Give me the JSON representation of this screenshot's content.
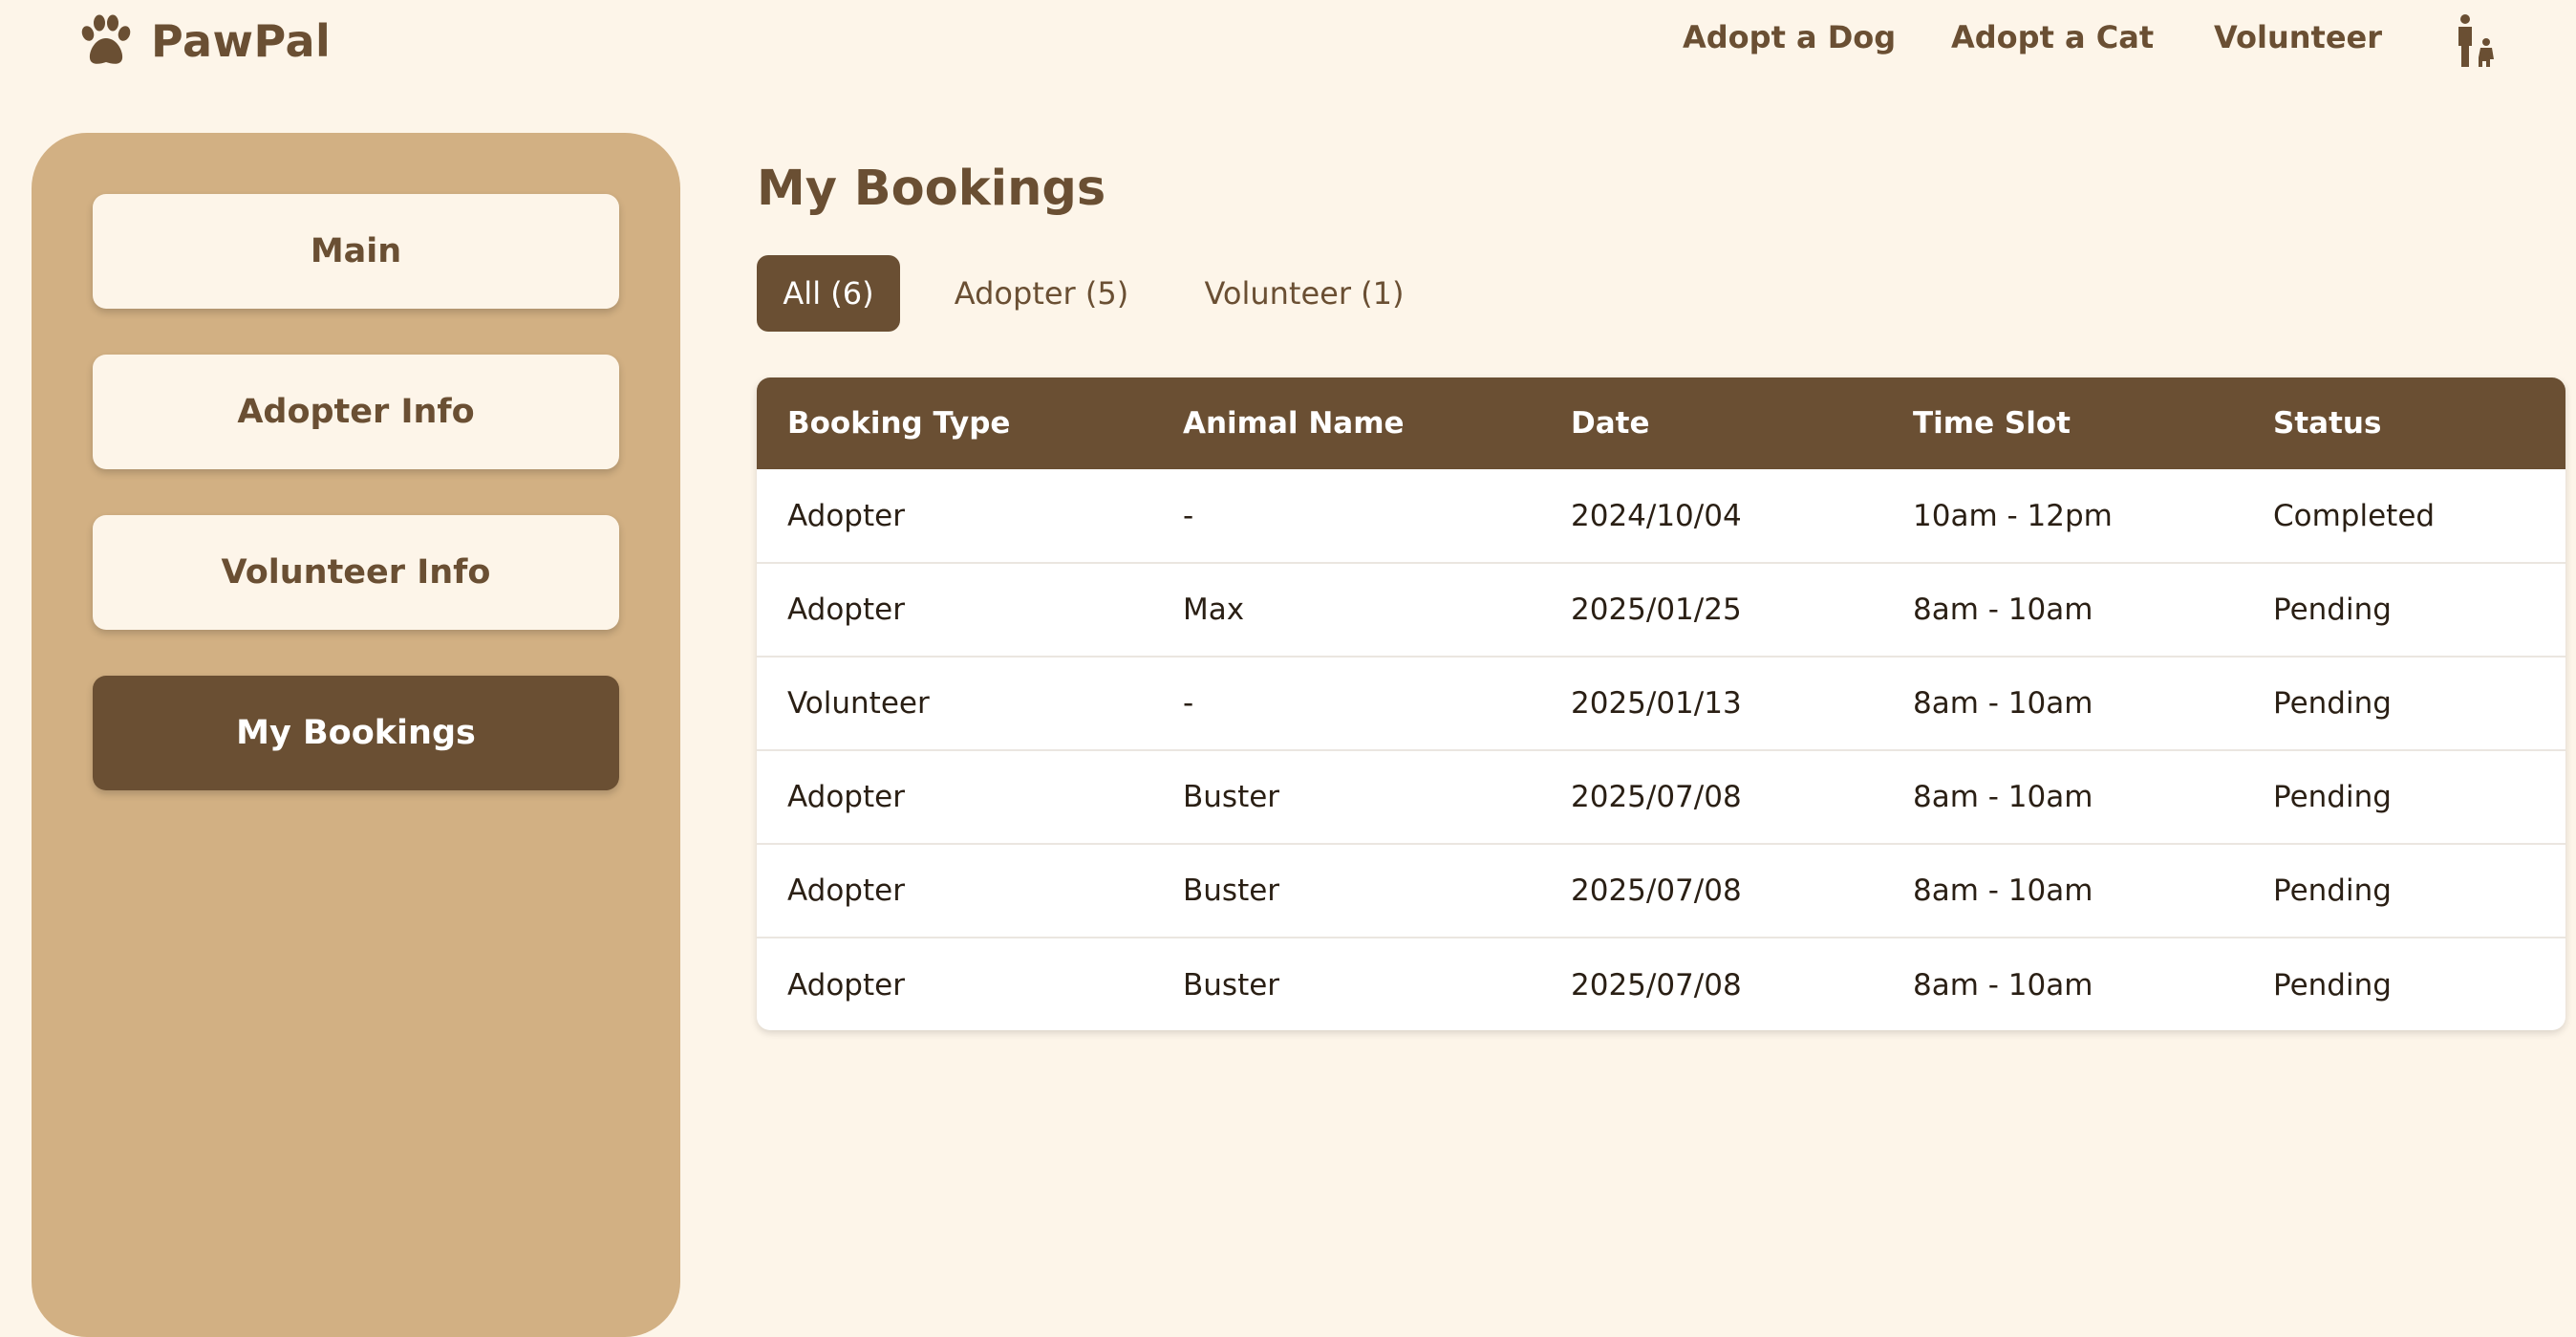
{
  "brand": {
    "name": "PawPal"
  },
  "nav": {
    "links": [
      "Adopt a Dog",
      "Adopt a Cat",
      "Volunteer"
    ]
  },
  "sidebar": {
    "items": [
      {
        "label": "Main",
        "active": false
      },
      {
        "label": "Adopter Info",
        "active": false
      },
      {
        "label": "Volunteer Info",
        "active": false
      },
      {
        "label": "My Bookings",
        "active": true
      }
    ]
  },
  "main": {
    "title": "My Bookings",
    "tabs": [
      {
        "label": "All (6)",
        "active": true
      },
      {
        "label": "Adopter (5)",
        "active": false
      },
      {
        "label": "Volunteer (1)",
        "active": false
      }
    ],
    "table": {
      "columns": [
        "Booking Type",
        "Animal Name",
        "Date",
        "Time Slot",
        "Status"
      ],
      "rows": [
        [
          "Adopter",
          "-",
          "2024/10/04",
          "10am - 12pm",
          "Completed"
        ],
        [
          "Adopter",
          "Max",
          "2025/01/25",
          "8am - 10am",
          "Pending"
        ],
        [
          "Volunteer",
          "-",
          "2025/01/13",
          "8am - 10am",
          "Pending"
        ],
        [
          "Adopter",
          "Buster",
          "2025/07/08",
          "8am - 10am",
          "Pending"
        ],
        [
          "Adopter",
          "Buster",
          "2025/07/08",
          "8am - 10am",
          "Pending"
        ],
        [
          "Adopter",
          "Buster",
          "2025/07/08",
          "8am - 10am",
          "Pending"
        ]
      ]
    }
  },
  "icons": {
    "brand": "paw-icon",
    "user": "person-with-dog-icon"
  },
  "colors": {
    "background": "#fdf5e9",
    "sidebar": "#d2b083",
    "primary": "#6a4f33",
    "table_bg": "#ffffff"
  }
}
